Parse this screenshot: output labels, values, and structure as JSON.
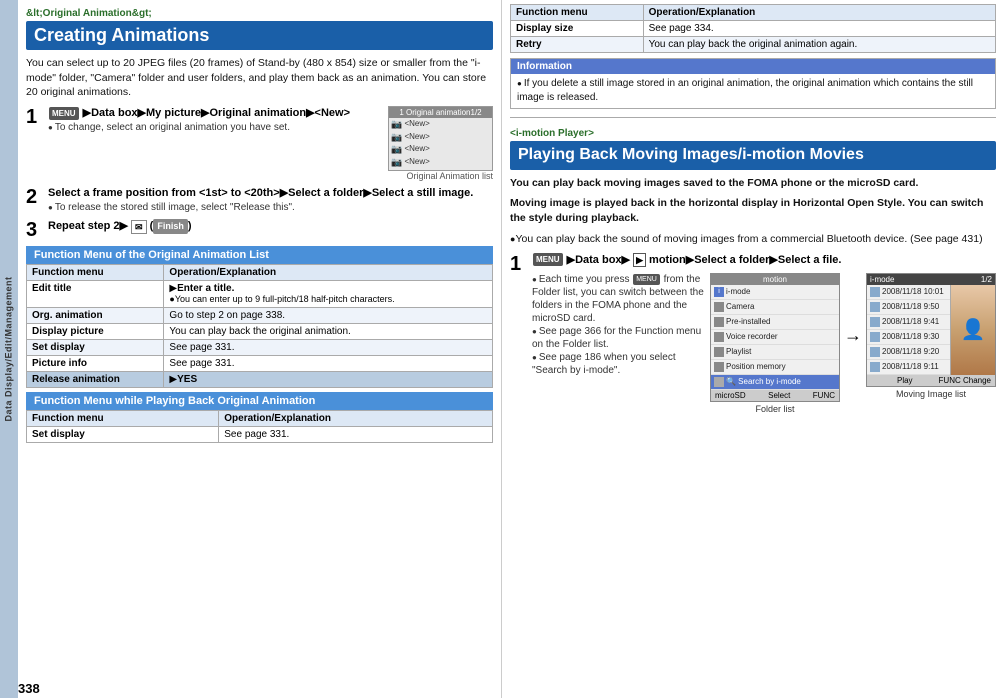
{
  "page": {
    "number": "338"
  },
  "left": {
    "section_tag": "&lt;Original Animation&gt;",
    "section_title": "Creating Animations",
    "intro_text": "You can select up to 20 JPEG files (20 frames) of Stand-by (480 x 854) size or smaller from the \"i-mode\" folder, \"Camera\" folder and user folders, and play them back as an animation. You can store 20 original animations.",
    "steps": [
      {
        "num": "1",
        "text": "▶Data box▶My picture▶Original animation▶<New>",
        "note": "To change, select an original animation you have set."
      },
      {
        "num": "2",
        "text": "Select a frame position from <1st> to <20th>▶Select a folder▶Select a still image.",
        "note": "To release the stored still image, select \"Release this\"."
      },
      {
        "num": "3",
        "text": "Repeat step 2▶",
        "finish": "Finish"
      }
    ],
    "sim_screen": {
      "title": "1 Original animation1/2",
      "rows": [
        "<New>",
        "<New>",
        "<New>",
        "<New>"
      ]
    },
    "sim_label": "Original Animation list",
    "func_menu_section": {
      "title": "Function Menu of the Original Animation List",
      "headers": [
        "Function menu",
        "Operation/Explanation"
      ],
      "rows": [
        {
          "menu": "Edit title",
          "op": "▶Enter a title.\n●You can enter up to 9 full-pitch/18 half-pitch characters.",
          "shaded": false
        },
        {
          "menu": "Org. animation",
          "op": "Go to step 2 on page 338.",
          "shaded": true
        },
        {
          "menu": "Display picture",
          "op": "You can play back the original animation.",
          "shaded": false
        },
        {
          "menu": "Set display",
          "op": "See page 331.",
          "shaded": true
        },
        {
          "menu": "Picture info",
          "op": "See page 331.",
          "shaded": false
        },
        {
          "menu": "Release animation",
          "op": "▶YES",
          "shaded": true,
          "dark": true
        }
      ]
    },
    "func_menu_while": {
      "title": "Function Menu while Playing Back Original Animation",
      "headers": [
        "Function menu",
        "Operation/Explanation"
      ],
      "rows": [
        {
          "menu": "Set display",
          "op": "See page 331.",
          "shaded": false
        }
      ]
    },
    "func_menu_table2": {
      "headers": [
        "Function menu",
        "Operation/Explanation"
      ],
      "rows": [
        {
          "menu": "Display size",
          "op": "See page 334.",
          "shaded": false
        },
        {
          "menu": "Retry",
          "op": "You can play back the original animation again.",
          "shaded": true
        }
      ]
    },
    "info_box": {
      "title": "Information",
      "text": "If you delete a still image stored in an original animation, the original animation which contains the still image is released."
    }
  },
  "right": {
    "section_tag": "&lt;i-motion Player&gt;",
    "section_title": "Playing Back Moving Images/i-motion Movies",
    "intro_lines": [
      "You can play back moving images saved to the FOMA phone or the microSD card.",
      "Moving image is played back in the horizontal display in Horizontal Open Style. You can switch the style during playback.",
      "You can play back the sound of moving images from a commercial Bluetooth device. (See page 431)"
    ],
    "step1": {
      "num": "1",
      "text": "▶Data box▶ motion▶Select a folder▶Select a file.",
      "notes": [
        "Each time you press MENU from the Folder list, you can switch between the folders in the FOMA phone and the microSD card.",
        "See page 366 for the Function menu on the Folder list.",
        "See page 186 when you select \"Search by i-mode\"."
      ]
    },
    "folder_screen": {
      "title": "motion",
      "rows": [
        {
          "label": "i-mode",
          "highlighted": false
        },
        {
          "label": "Camera",
          "highlighted": false
        },
        {
          "label": "Pre-installed",
          "highlighted": false
        },
        {
          "label": "Voice recorder",
          "highlighted": false
        },
        {
          "label": "Playlist",
          "highlighted": false
        },
        {
          "label": "Position memory",
          "highlighted": false
        },
        {
          "label": "Search by i-mode",
          "highlighted": true
        }
      ],
      "bottom": [
        "microSD",
        "Select",
        "FUNC"
      ]
    },
    "moving_image_screen": {
      "title": "i-mode  1/2",
      "rows": [
        {
          "label": "2008/11/18 10:01",
          "highlighted": false
        },
        {
          "label": "2008/11/18  9:50",
          "highlighted": false
        },
        {
          "label": "2008/11/18  9:41",
          "highlighted": false
        },
        {
          "label": "2008/11/18  9:30",
          "highlighted": false
        },
        {
          "label": "2008/11/18  9:20",
          "highlighted": false
        },
        {
          "label": "2008/11/18  9:11",
          "highlighted": false
        }
      ],
      "bottom": [
        "",
        "Play",
        "FUNC Change"
      ]
    },
    "folder_label": "Folder list",
    "moving_label": "Moving Image list"
  }
}
